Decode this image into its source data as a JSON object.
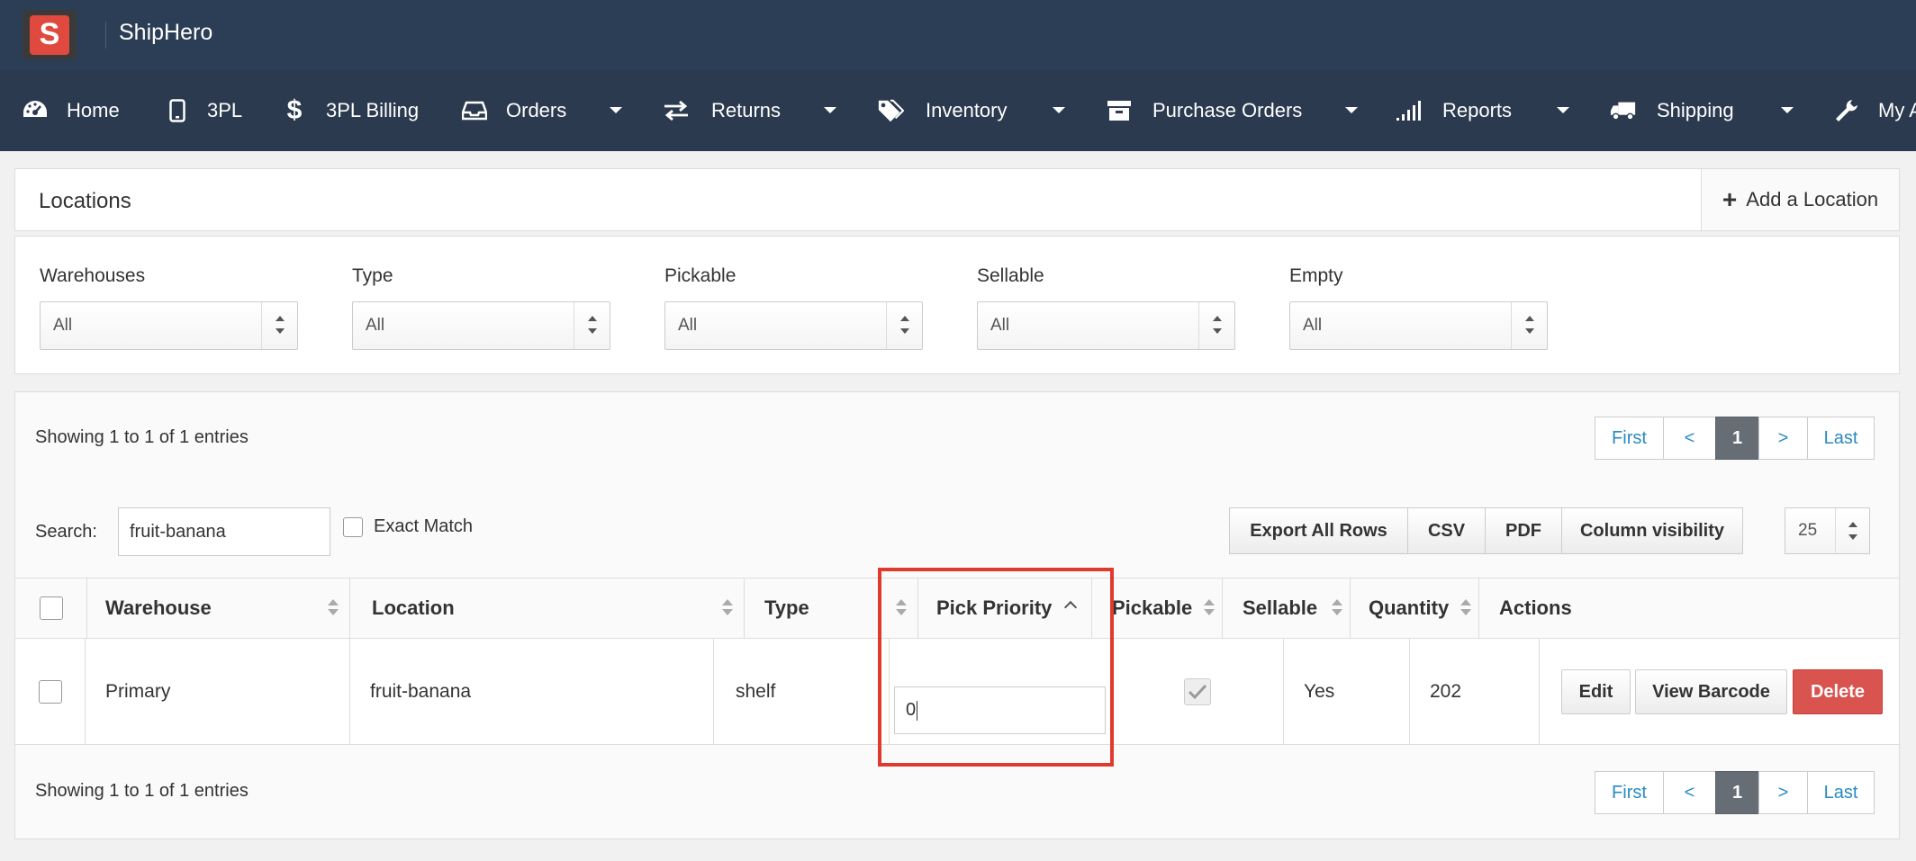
{
  "app": {
    "brand": "ShipHero",
    "logo_letter": "S"
  },
  "nav": [
    {
      "label": "Home",
      "icon": "dashboard-icon"
    },
    {
      "label": "3PL",
      "icon": "tablet-icon"
    },
    {
      "label": "3PL Billing",
      "icon": "dollar-icon"
    },
    {
      "label": "Orders",
      "icon": "inbox-icon"
    },
    {
      "label": "Returns",
      "icon": "exchange-icon"
    },
    {
      "label": "Inventory",
      "icon": "tags-icon"
    },
    {
      "label": "Purchase Orders",
      "icon": "archive-icon"
    },
    {
      "label": "Reports",
      "icon": "signal-icon"
    },
    {
      "label": "Shipping",
      "icon": "truck-icon"
    },
    {
      "label": "My A",
      "icon": "wrench-icon"
    }
  ],
  "locations_panel": {
    "title": "Locations",
    "add_label": "Add a Location"
  },
  "filters": [
    {
      "label": "Warehouses",
      "value": "All"
    },
    {
      "label": "Type",
      "value": "All"
    },
    {
      "label": "Pickable",
      "value": "All"
    },
    {
      "label": "Sellable",
      "value": "All"
    },
    {
      "label": "Empty",
      "value": "All"
    }
  ],
  "table": {
    "showing_top": "Showing 1 to 1 of 1 entries",
    "showing_bottom": "Showing 1 to 1 of 1 entries",
    "pager": {
      "first": "First",
      "prev": "<",
      "current": "1",
      "next": ">",
      "last": "Last"
    },
    "search_label": "Search:",
    "search_value": "fruit-banana",
    "exact_match_label": "Exact Match",
    "export_buttons": [
      "Export All Rows",
      "CSV",
      "PDF",
      "Column visibility"
    ],
    "page_length": "25",
    "columns": [
      "Warehouse",
      "Location",
      "Type",
      "Pick Priority",
      "Pickable",
      "Sellable",
      "Quantity",
      "Actions"
    ],
    "row": {
      "warehouse": "Primary",
      "location": "fruit-banana",
      "type": "shelf",
      "pick_priority": "0",
      "sellable": "Yes",
      "quantity": "202",
      "actions": [
        "Edit",
        "View Barcode",
        "Delete"
      ]
    }
  },
  "colors": {
    "topbar": "#2c3e55",
    "navbar": "#2b3a4f",
    "highlight": "#e03a2f",
    "danger": "#d9534f",
    "link": "#2a8ac0"
  }
}
